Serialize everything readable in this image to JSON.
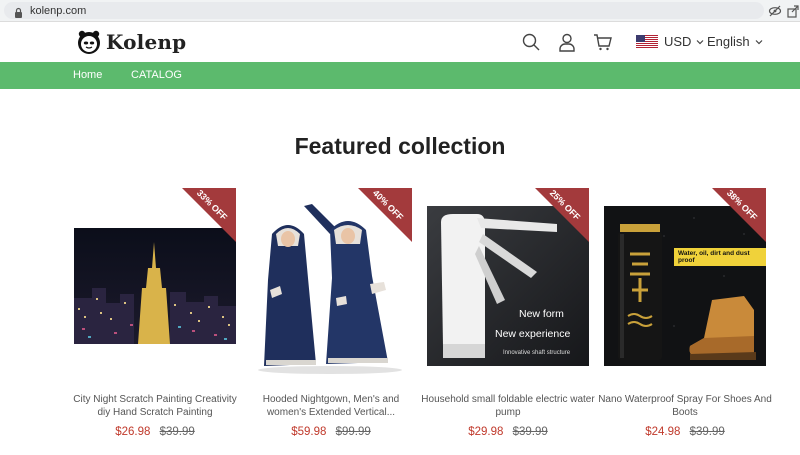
{
  "browser": {
    "url": "kolenp.com"
  },
  "header": {
    "logo_text": "Kolenp",
    "currency": "USD",
    "language": "English"
  },
  "nav": {
    "items": [
      {
        "label": "Home"
      },
      {
        "label": "CATALOG"
      }
    ]
  },
  "section": {
    "title": "Featured collection"
  },
  "products": [
    {
      "name": "City Night Scratch Painting Creativity diy Hand Scratch Painting",
      "price": "$26.98",
      "old_price": "$39.99",
      "badge": "33% OFF",
      "image_icon": "city-night-skyline"
    },
    {
      "name": "Hooded Nightgown, Men's and women's Extended Vertical...",
      "price": "$59.98",
      "old_price": "$99.99",
      "badge": "40% OFF",
      "image_icon": "hooded-robe-models"
    },
    {
      "name": "Household small foldable electric water pump",
      "price": "$29.98",
      "old_price": "$39.99",
      "badge": "25% OFF",
      "image_icon": "water-pump",
      "image_text": {
        "line1": "New form",
        "line2": "New experience",
        "caption": "Innovative shaft structure"
      }
    },
    {
      "name": "Nano Waterproof Spray For Shoes And Boots",
      "price": "$24.98",
      "old_price": "$39.99",
      "badge": "38% OFF",
      "image_icon": "spray-can-and-boot",
      "image_text": {
        "label": "Water, oil, dirt and dust proof",
        "can_text": "スプレー"
      }
    }
  ],
  "colors": {
    "nav_green": "#5cba6d",
    "badge_red": "#a33a3c",
    "price_red": "#c0392b"
  }
}
